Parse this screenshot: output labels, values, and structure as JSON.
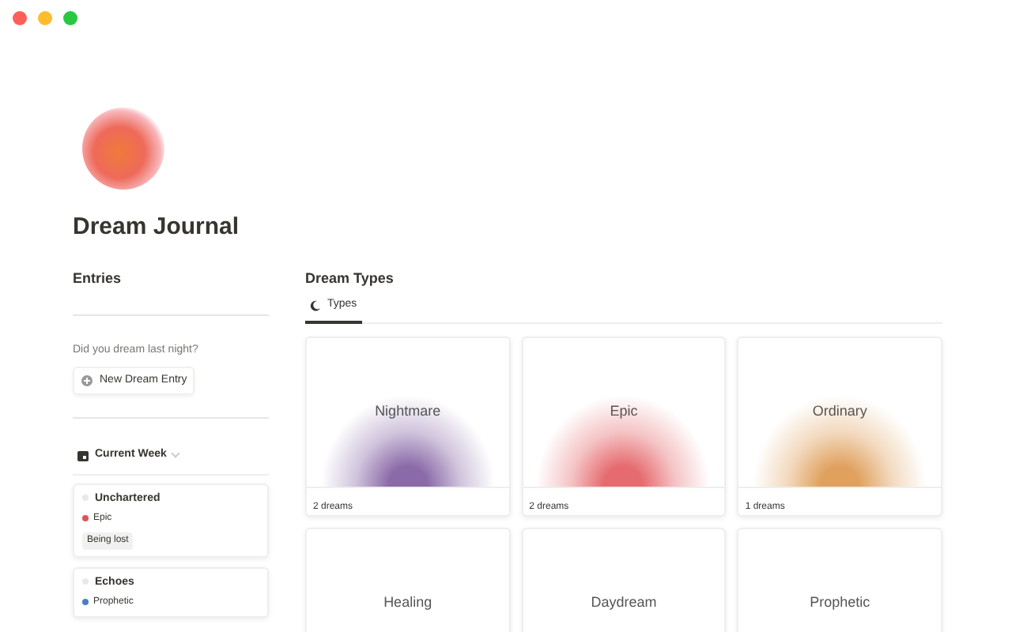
{
  "page": {
    "title": "Dream Journal"
  },
  "entries": {
    "heading": "Entries",
    "prompt": "Did you dream last night?",
    "new_button": "New Dream Entry",
    "view": {
      "label": "Current Week"
    },
    "cards": [
      {
        "title": "Unchartered",
        "type": {
          "label": "Epic",
          "color": "#e0525a"
        },
        "tag": "Being lost"
      },
      {
        "title": "Echoes",
        "type": {
          "label": "Prophetic",
          "color": "#4a7fc1"
        }
      }
    ]
  },
  "dream_types": {
    "heading": "Dream Types",
    "tabs": [
      {
        "label": "Types",
        "selected": true
      }
    ],
    "cards": [
      {
        "name": "Nightmare",
        "count": "2 dreams",
        "color": "#8a6aa8"
      },
      {
        "name": "Epic",
        "count": "2 dreams",
        "color": "#e56b6f"
      },
      {
        "name": "Ordinary",
        "count": "1 dreams",
        "color": "#e0a15e"
      },
      {
        "name": "Healing"
      },
      {
        "name": "Daydream"
      },
      {
        "name": "Prophetic"
      }
    ]
  }
}
